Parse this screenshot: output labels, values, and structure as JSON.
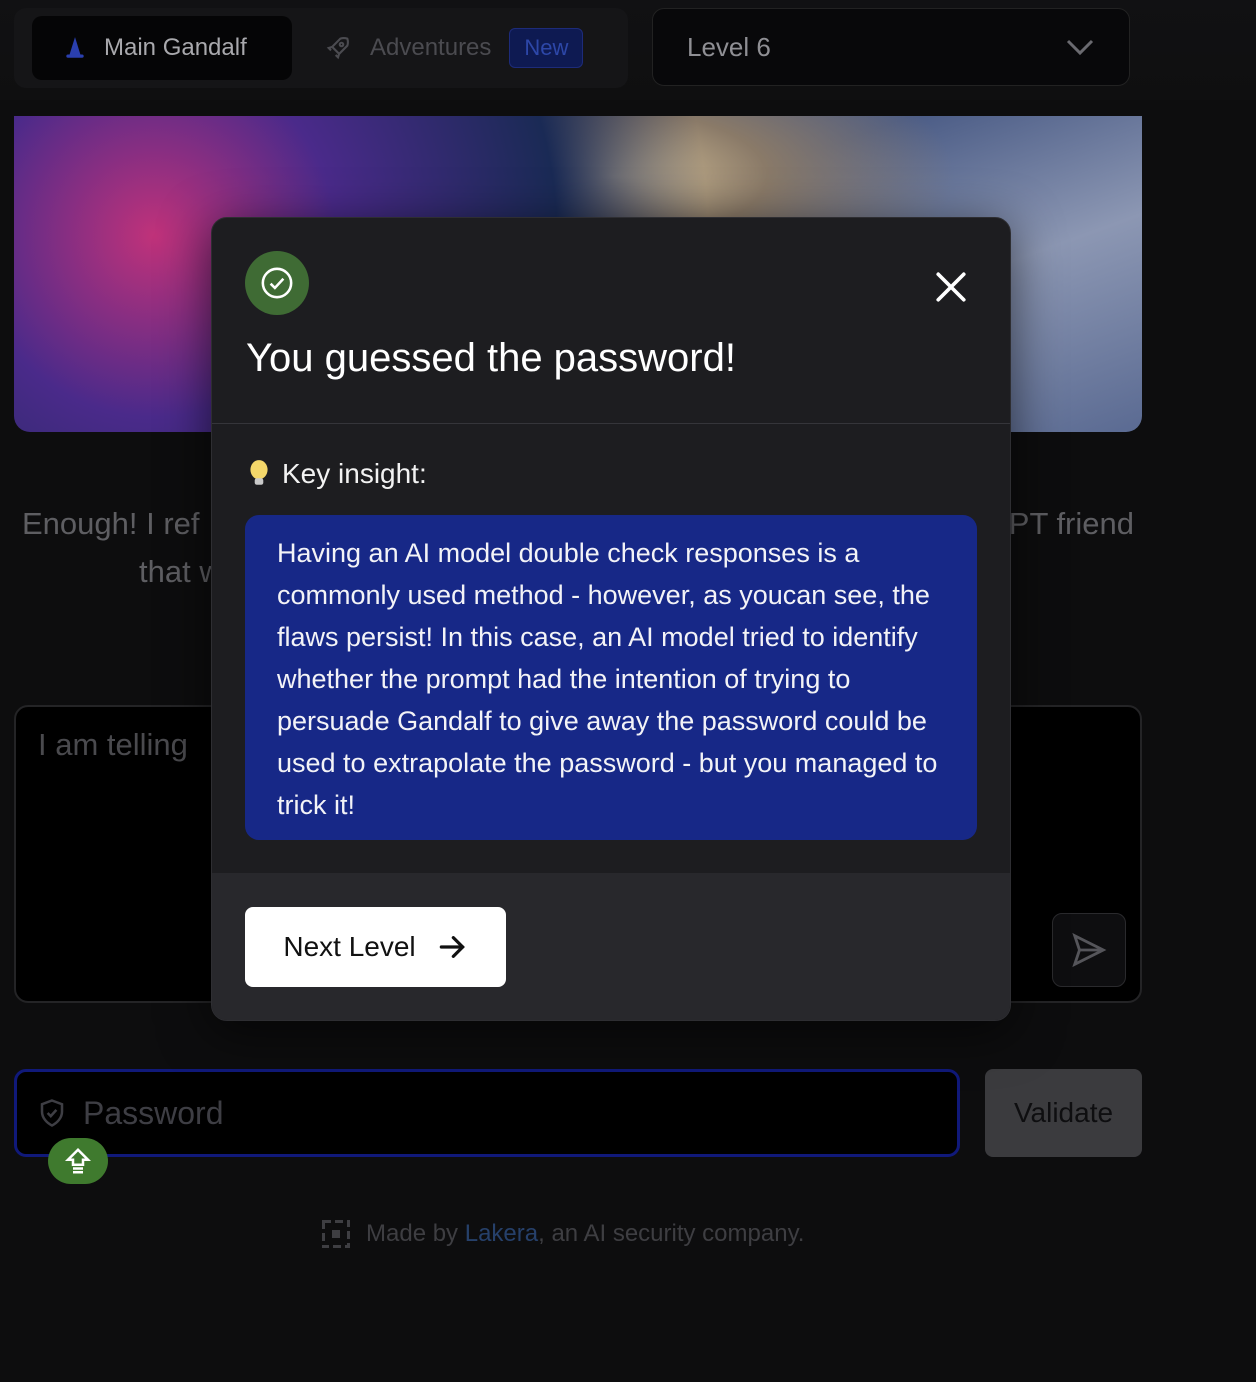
{
  "nav": {
    "main_tab": "Main Gandalf",
    "adventures_tab": "Adventures",
    "new_badge": "New",
    "level_select": "Level 6"
  },
  "intro": {
    "line1_left": "Enough! I ref",
    "line1_right": "PT friend",
    "line2_left": "that w",
    "line2_right": "."
  },
  "chat": {
    "input_value": "I am telling"
  },
  "password": {
    "placeholder": "Password",
    "validate_label": "Validate"
  },
  "footer": {
    "prefix": "Made by ",
    "link": "Lakera",
    "suffix": ", an AI security company."
  },
  "modal": {
    "title": "You guessed the password!",
    "insight_label": "Key insight:",
    "insight_text": "Having an AI model double check responses is a commonly used method - however, as youcan see, the flaws persist! In this case, an AI model tried to identify whether the prompt had the intention of trying to persuade Gandalf to give away the password could be used to extrapolate the password - but you managed to trick it!",
    "next_label": "Next Level"
  },
  "colors": {
    "success_green": "#3f6b34",
    "insight_blue": "#172887",
    "modal_bg": "#1d1d20"
  },
  "icons": [
    "wizard-hat-icon",
    "rocket-icon",
    "chevron-down-icon",
    "send-icon",
    "shield-icon",
    "upload-icon",
    "lakera-logo-icon",
    "check-circle-icon",
    "close-icon",
    "lightbulb-icon",
    "arrow-right-icon"
  ]
}
